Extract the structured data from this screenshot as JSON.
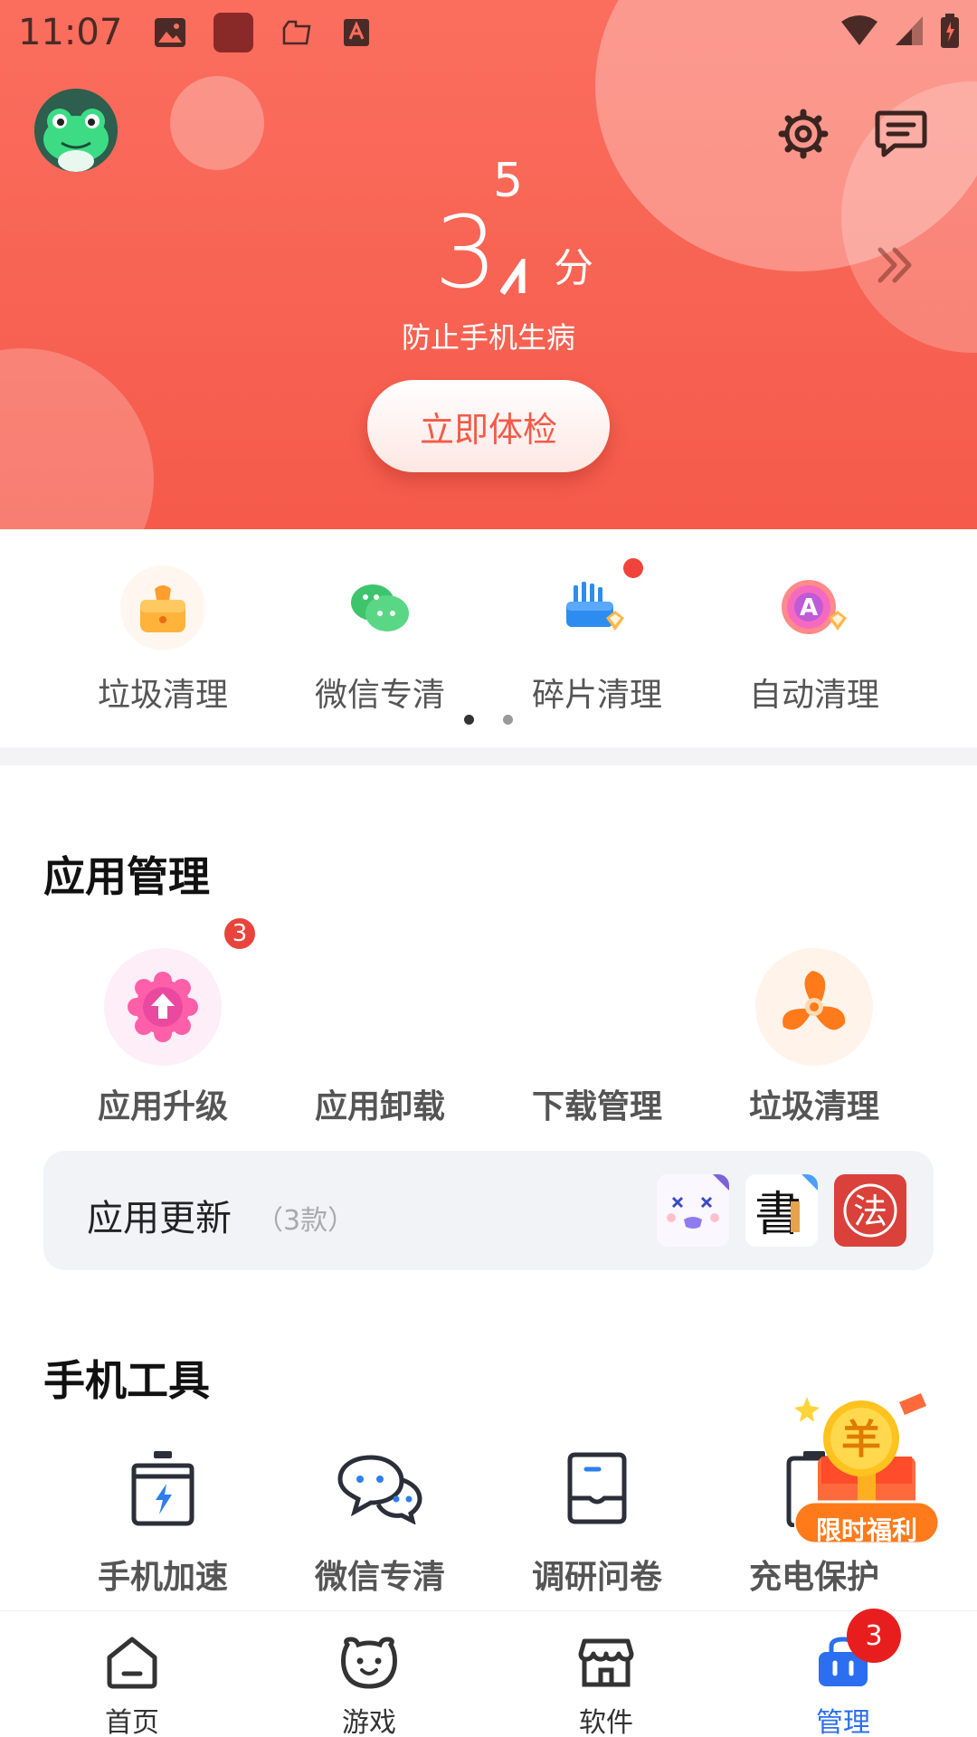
{
  "status_bar": {
    "time": "11:07"
  },
  "hero": {
    "score_top": "5",
    "score_main": "3",
    "score_unit": "分",
    "subtitle": "防止手机生病",
    "check_button": "立即体检",
    "accent_color": "#f55a4a"
  },
  "quick_tools": [
    {
      "label": "垃圾清理",
      "icon": "trash-bag-icon"
    },
    {
      "label": "微信专清",
      "icon": "wechat-icon"
    },
    {
      "label": "碎片清理",
      "icon": "fragment-icon"
    },
    {
      "label": "自动清理",
      "icon": "auto-clean-icon"
    }
  ],
  "app_management": {
    "title": "应用管理",
    "items": [
      {
        "label": "应用升级",
        "icon": "app-upgrade-icon",
        "badge": "3"
      },
      {
        "label": "应用卸载",
        "icon": "app-uninstall-icon"
      },
      {
        "label": "下载管理",
        "icon": "download-icon"
      },
      {
        "label": "垃圾清理",
        "icon": "fan-icon"
      }
    ],
    "update_bar": {
      "title": "应用更新",
      "count": "（3款）"
    }
  },
  "phone_tools": {
    "title": "手机工具",
    "items": [
      {
        "label": "手机加速",
        "icon": "speedup-icon"
      },
      {
        "label": "微信专清",
        "icon": "chat-bubbles-icon"
      },
      {
        "label": "调研问卷",
        "icon": "survey-icon"
      },
      {
        "label": "充电保护",
        "icon": "battery-icon"
      }
    ],
    "promo_label": "限时福利",
    "promo_symbol": "羊"
  },
  "bottom_nav": {
    "items": [
      {
        "label": "首页",
        "icon": "home-icon"
      },
      {
        "label": "游戏",
        "icon": "game-icon"
      },
      {
        "label": "软件",
        "icon": "store-icon"
      },
      {
        "label": "管理",
        "icon": "manage-bag-icon",
        "active": true
      }
    ],
    "manage_badge": "3",
    "active_color": "#2b6ff0"
  }
}
